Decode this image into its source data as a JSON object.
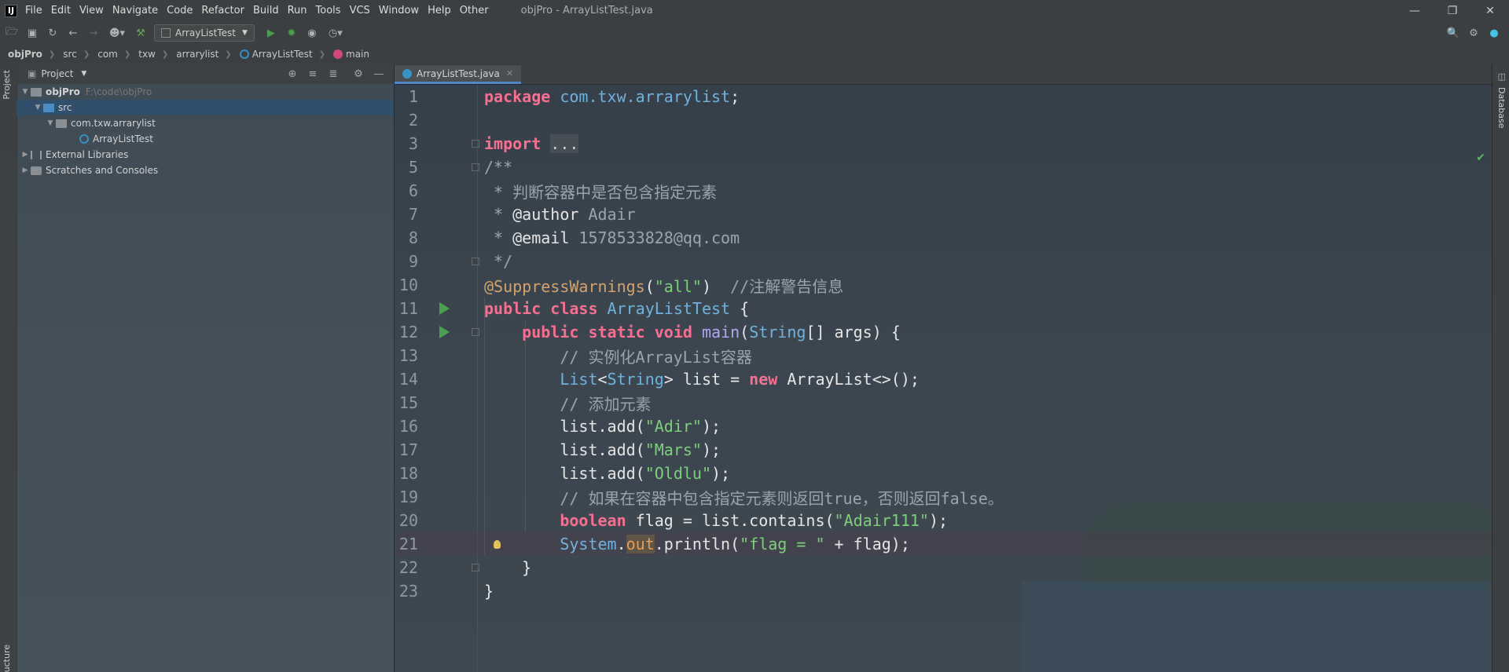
{
  "menubar": {
    "logo": "IJ",
    "items": [
      "File",
      "Edit",
      "View",
      "Navigate",
      "Code",
      "Refactor",
      "Build",
      "Run",
      "Tools",
      "VCS",
      "Window",
      "Help",
      "Other"
    ],
    "title": "objPro - ArrayListTest.java"
  },
  "toolbar": {
    "run_config": "ArrayListTest"
  },
  "breadcrumb": {
    "items": [
      "objPro",
      "src",
      "com",
      "txw",
      "arrarylist",
      "ArrayListTest",
      "main"
    ]
  },
  "left_strip": {
    "project_label": "Project",
    "structure_label": "ucture"
  },
  "project_panel": {
    "title": "Project",
    "tree": [
      {
        "label": "objPro",
        "path": "F:\\code\\objPro",
        "level": 0,
        "expanded": true,
        "bold": true
      },
      {
        "label": "src",
        "level": 1,
        "expanded": true,
        "selected": true
      },
      {
        "label": "com.txw.arrarylist",
        "level": 2,
        "expanded": true
      },
      {
        "label": "ArrayListTest",
        "level": 3
      },
      {
        "label": "External Libraries",
        "level": 0,
        "expanded": false
      },
      {
        "label": "Scratches and Consoles",
        "level": 0,
        "expanded": false
      }
    ]
  },
  "editor": {
    "tab_label": "ArrayListTest.java",
    "line_numbers": [
      "1",
      "2",
      "3",
      "5",
      "6",
      "7",
      "8",
      "9",
      "10",
      "11",
      "12",
      "13",
      "14",
      "15",
      "16",
      "17",
      "18",
      "19",
      "20",
      "21",
      "22",
      "23"
    ]
  },
  "right_strip": {
    "label": "Database"
  },
  "colors": {
    "accent": "#4a88c7",
    "run_green": "#49a14b",
    "keyword": "#f76f91",
    "string": "#7dd07a"
  }
}
